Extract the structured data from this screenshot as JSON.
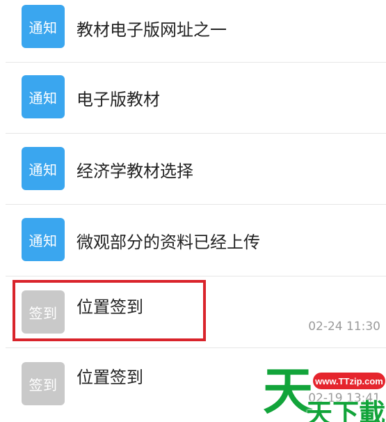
{
  "colors": {
    "notice_badge": "#3aa6ef",
    "checkin_badge": "#c9c9c9",
    "highlight_border": "#d9242b",
    "watermark_green": "#12a43a",
    "watermark_red": "#e5252d"
  },
  "items": [
    {
      "badge": "通知",
      "title": "教材电子版网址之一",
      "time": ""
    },
    {
      "badge": "通知",
      "title": "电子版教材",
      "time": ""
    },
    {
      "badge": "通知",
      "title": "经济学教材选择",
      "time": ""
    },
    {
      "badge": "通知",
      "title": "微观部分的资料已经上传",
      "time": ""
    },
    {
      "badge": "签到",
      "title": "位置签到",
      "time": "02-24 11:30"
    },
    {
      "badge": "签到",
      "title": "位置签到",
      "time": "02-19 13:41"
    }
  ],
  "watermark": {
    "url": "www.TTzip.com",
    "chars": [
      "天",
      "天",
      "下",
      "載"
    ]
  }
}
